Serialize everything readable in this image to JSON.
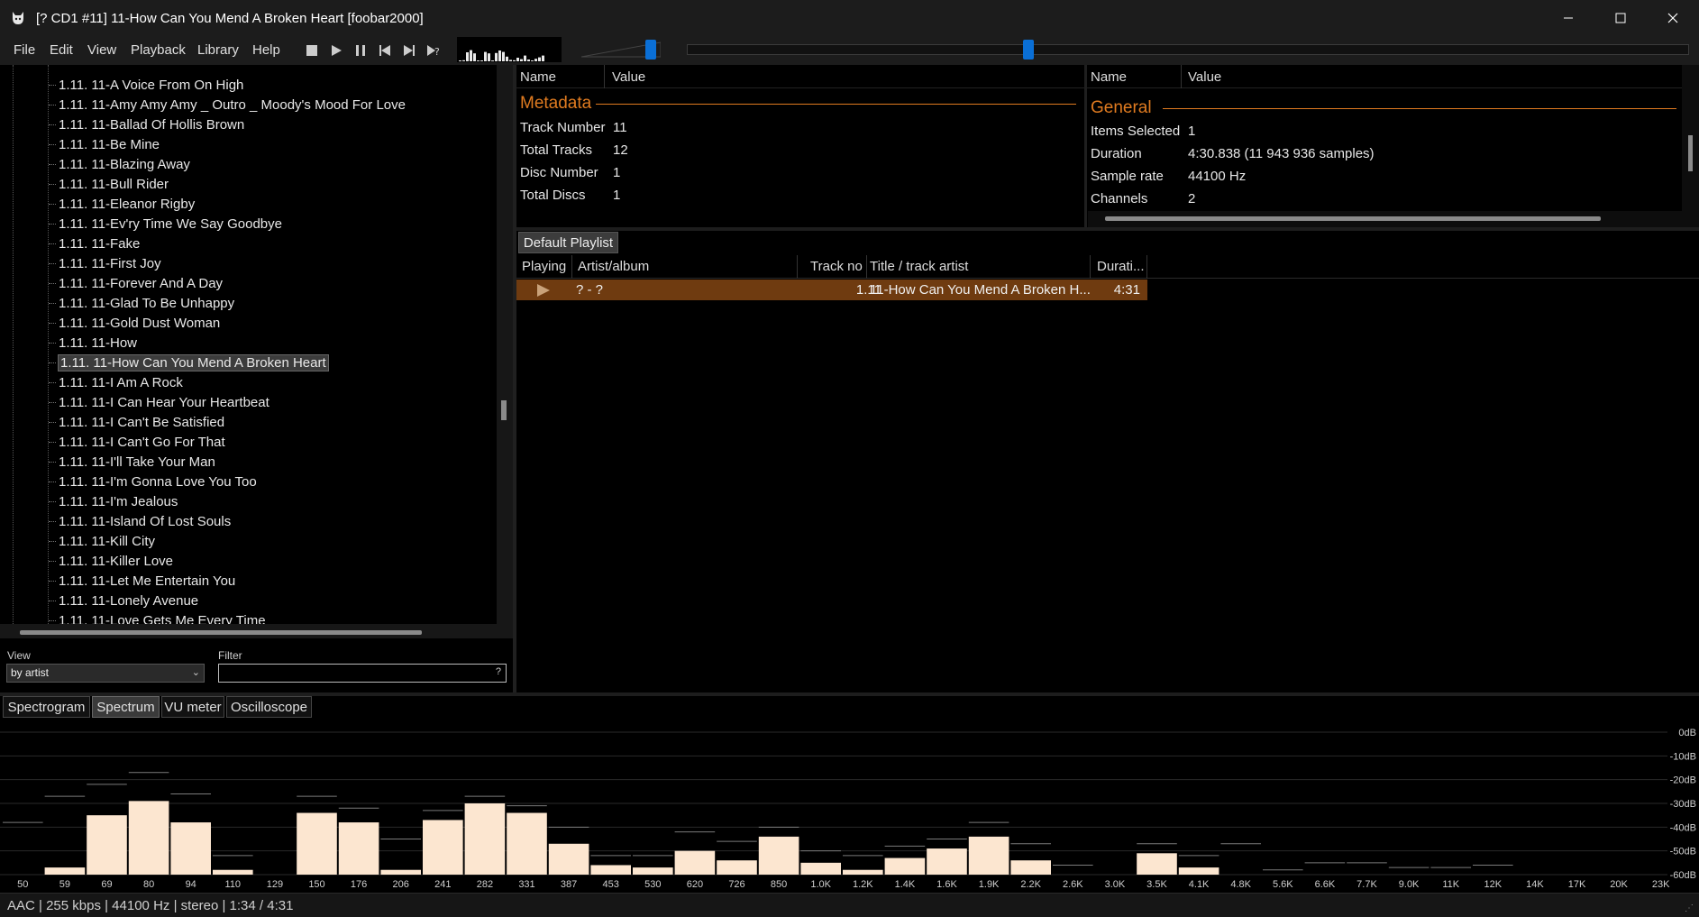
{
  "window": {
    "title": "[? CD1 #11] 11-How Can You Mend A Broken Heart  [foobar2000]",
    "minimize_icon": "minimize-icon",
    "maximize_icon": "maximize-icon",
    "close_icon": "close-icon"
  },
  "menu": [
    "File",
    "Edit",
    "View",
    "Playback",
    "Library",
    "Help"
  ],
  "toolbar": {
    "buttons": [
      "stop-icon",
      "play-icon",
      "pause-icon",
      "previous-icon",
      "next-icon",
      "random-icon"
    ],
    "volume_level": 0.88,
    "seek_position": 0.34
  },
  "tree": {
    "items": [
      "1.11. 11-A Voice From On High",
      "1.11. 11-Amy Amy Amy _ Outro _ Moody's Mood For Love",
      "1.11. 11-Ballad Of Hollis Brown",
      "1.11. 11-Be Mine",
      "1.11. 11-Blazing Away",
      "1.11. 11-Bull Rider",
      "1.11. 11-Eleanor Rigby",
      "1.11. 11-Ev'ry Time We Say Goodbye",
      "1.11. 11-Fake",
      "1.11. 11-First Joy",
      "1.11. 11-Forever And A Day",
      "1.11. 11-Glad To Be Unhappy",
      "1.11. 11-Gold Dust Woman",
      "1.11. 11-How",
      "1.11. 11-How Can You Mend A Broken Heart",
      "1.11. 11-I Am A Rock",
      "1.11. 11-I Can Hear Your Heartbeat",
      "1.11. 11-I Can't Be Satisfied",
      "1.11. 11-I Can't Go For That",
      "1.11. 11-I'll Take Your Man",
      "1.11. 11-I'm Gonna Love You Too",
      "1.11. 11-I'm Jealous",
      "1.11. 11-Island Of Lost Souls",
      "1.11. 11-Kill City",
      "1.11. 11-Killer Love",
      "1.11. 11-Let Me Entertain You",
      "1.11. 11-Lonely Avenue",
      "1.11. 11-Love Gets Me Every Time"
    ],
    "selected_index": 14
  },
  "view_filter": {
    "view_label": "View",
    "view_value": "by artist",
    "filter_label": "Filter",
    "filter_value": "",
    "filter_help": "?"
  },
  "metadata_panel": {
    "col_name": "Name",
    "col_value": "Value",
    "section": "Metadata",
    "rows": [
      {
        "name": "Track Number",
        "value": "11"
      },
      {
        "name": "Total Tracks",
        "value": "12"
      },
      {
        "name": "Disc Number",
        "value": "1"
      },
      {
        "name": "Total Discs",
        "value": "1"
      }
    ]
  },
  "general_panel": {
    "col_name": "Name",
    "col_value": "Value",
    "section": "General",
    "rows": [
      {
        "name": "Items Selected",
        "value": "1"
      },
      {
        "name": "Duration",
        "value": "4:30.838 (11 943 936 samples)"
      },
      {
        "name": "Sample rate",
        "value": "44100 Hz"
      },
      {
        "name": "Channels",
        "value": "2"
      }
    ]
  },
  "playlist": {
    "tab": "Default Playlist",
    "columns": [
      "Playing",
      "Artist/album",
      "Track no",
      "Title / track artist",
      "Durati..."
    ],
    "rows": [
      {
        "artist": "? - ?",
        "track": "1.11",
        "title": "11-How Can You Mend A Broken H...",
        "duration": "4:31"
      }
    ]
  },
  "viz_tabs": [
    "Spectrogram",
    "Spectrum",
    "VU meter",
    "Oscilloscope"
  ],
  "viz_active": 1,
  "spectrum": {
    "db_labels": [
      "0dB",
      "-10dB",
      "-20dB",
      "-30dB",
      "-40dB",
      "-50dB",
      "-60dB"
    ],
    "freq_labels": [
      "50",
      "59",
      "69",
      "80",
      "94",
      "110",
      "129",
      "150",
      "176",
      "206",
      "241",
      "282",
      "331",
      "387",
      "453",
      "530",
      "620",
      "726",
      "850",
      "1.0K",
      "1.2K",
      "1.4K",
      "1.6K",
      "1.9K",
      "2.2K",
      "2.6K",
      "3.0K",
      "3.5K",
      "4.1K",
      "4.8K",
      "5.6K",
      "6.6K",
      "7.7K",
      "9.0K",
      "11K",
      "12K",
      "14K",
      "17K",
      "20K",
      "23K"
    ],
    "bar_db": [
      -60,
      -57,
      -35,
      -29,
      -38,
      -58,
      -60,
      -34,
      -38,
      -58,
      -37,
      -30,
      -34,
      -47,
      -56,
      -57,
      -50,
      -54,
      -44,
      -55,
      -58,
      -53,
      -49,
      -44,
      -54,
      -60,
      -60,
      -51,
      -57,
      -60,
      -60,
      -60,
      -60,
      -60,
      -60,
      -60,
      -60,
      -60,
      -60,
      -60
    ],
    "peak_db": [
      -38,
      -27,
      -22,
      -17,
      -26,
      -52,
      -60,
      -27,
      -32,
      -45,
      -33,
      -27,
      -31,
      -40,
      -52,
      -52,
      -42,
      -46,
      -40,
      -50,
      -52,
      -48,
      -45,
      -38,
      -47,
      -56,
      -60,
      -47,
      -52,
      -47,
      -58,
      -55,
      -55,
      -57,
      -57,
      -56,
      -60,
      -60,
      -60,
      -60
    ]
  },
  "status": "AAC | 255 kbps | 44100 Hz | stereo | 1:34 / 4:31"
}
